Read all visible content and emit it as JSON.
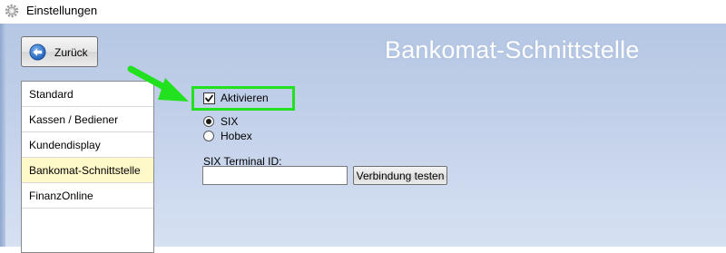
{
  "window": {
    "title": "Einstellungen",
    "icon": "gear-icon"
  },
  "header": {
    "back_label": "Zurück",
    "back_icon": "back-arrow-icon",
    "page_title": "Bankomat-Schnittstelle"
  },
  "sidebar": {
    "items": [
      {
        "label": "Standard",
        "active": false
      },
      {
        "label": "Kassen / Bediener",
        "active": false
      },
      {
        "label": "Kundendisplay",
        "active": false
      },
      {
        "label": "Bankomat-Schnittstelle",
        "active": true
      },
      {
        "label": "FinanzOnline",
        "active": false
      }
    ]
  },
  "form": {
    "activate_label": "Aktivieren",
    "activate_checked": true,
    "provider_options": [
      {
        "label": "SIX",
        "selected": true
      },
      {
        "label": "Hobex",
        "selected": false
      }
    ],
    "terminal_id_label": "SIX Terminal ID:",
    "terminal_id_value": "",
    "test_button_label": "Verbindung testen"
  },
  "annotation": {
    "arrow_color": "#22e21f",
    "highlight_color": "#22e21f"
  },
  "colors": {
    "background_top": "#b5c7e4",
    "background_bottom": "#d6e1f2",
    "active_item": "#fff8c8"
  }
}
